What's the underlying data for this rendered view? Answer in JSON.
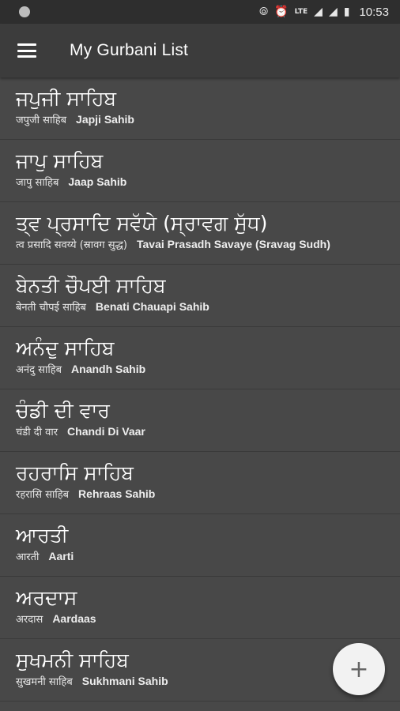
{
  "status_bar": {
    "time": "10:53",
    "icons": [
      "hotspot-icon",
      "alarm-icon",
      "volte-icon",
      "signal-icon",
      "battery-icon"
    ],
    "volte_label": "LTE"
  },
  "app_bar": {
    "title": "My Gurbani List",
    "menu_icon": "hamburger-menu-icon"
  },
  "list": {
    "items": [
      {
        "gurmukhi": "ਜਪੁਜੀ ਸਾਹਿਬ",
        "hindi": "जपुजी साहिब",
        "english": "Japji Sahib"
      },
      {
        "gurmukhi": "ਜਾਪੁ ਸਾਹਿਬ",
        "hindi": "जापु साहिब",
        "english": "Jaap Sahib"
      },
      {
        "gurmukhi": "ਤ੍ਵ ਪ੍ਰਸਾਦਿ ਸਵੱਯੇ (ਸ੍ਰਾਵਗ ਸੁੱਧ)",
        "hindi": "त्व प्रसादि सवय्ये (स्रावग सुद्ध)",
        "english": "Tavai Prasadh Savaye (Sravag Sudh)"
      },
      {
        "gurmukhi": "ਬੇਨਤੀ ਚੌਪਈ ਸਾਹਿਬ",
        "hindi": "बेनती चौपई साहिब",
        "english": "Benati Chauapi Sahib"
      },
      {
        "gurmukhi": "ਅਨੰਦੁ ਸਾਹਿਬ",
        "hindi": "अनंदु साहिब",
        "english": "Anandh Sahib"
      },
      {
        "gurmukhi": "ਚੰਡੀ ਦੀ ਵਾਰ",
        "hindi": "चंडी दी वार",
        "english": "Chandi Di Vaar"
      },
      {
        "gurmukhi": "ਰਹਰਾਸਿ ਸਾਹਿਬ",
        "hindi": "रहरासि साहिब",
        "english": "Rehraas Sahib"
      },
      {
        "gurmukhi": "ਆਰਤੀ",
        "hindi": "आरती",
        "english": "Aarti"
      },
      {
        "gurmukhi": "ਅਰਦਾਸ",
        "hindi": "अरदास",
        "english": "Aardaas"
      },
      {
        "gurmukhi": "ਸੁਖਮਨੀ ਸਾਹਿਬ",
        "hindi": "सुखमनी साहिब",
        "english": "Sukhmani Sahib"
      }
    ]
  },
  "fab": {
    "icon": "plus-icon",
    "glyph": "+"
  },
  "colors": {
    "background": "#484848",
    "app_bar": "#3c3c3c",
    "status_bar": "#2e2e2e",
    "fab": "#f2f2f2"
  }
}
